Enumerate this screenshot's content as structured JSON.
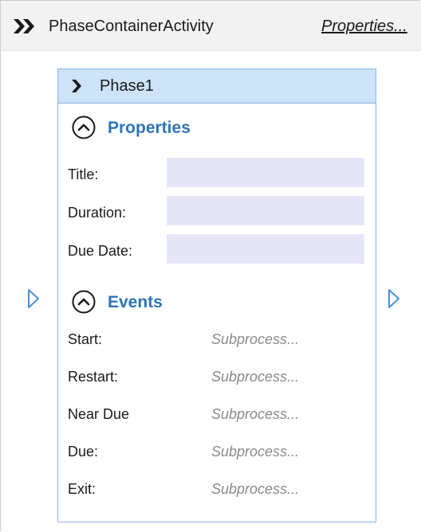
{
  "container": {
    "title": "PhaseContainerActivity",
    "properties_link": "Properties...",
    "icon": "double-chevron-right-icon"
  },
  "phase": {
    "title": "Phase1",
    "icon": "chevron-right-icon",
    "properties_section": {
      "title": "Properties",
      "icon": "chevron-up-circle-icon",
      "fields": [
        {
          "label": "Title:",
          "value": ""
        },
        {
          "label": "Duration:",
          "value": ""
        },
        {
          "label": "Due Date:",
          "value": ""
        }
      ]
    },
    "events_section": {
      "title": "Events",
      "icon": "chevron-up-circle-icon",
      "events": [
        {
          "label": "Start:",
          "value": "Subprocess..."
        },
        {
          "label": "Restart:",
          "value": "Subprocess..."
        },
        {
          "label": "Near Due",
          "value": "Subprocess..."
        },
        {
          "label": "Due:",
          "value": "Subprocess..."
        },
        {
          "label": "Exit:",
          "value": "Subprocess..."
        }
      ]
    }
  },
  "connectors": {
    "left_icon": "triangle-right-outline-icon",
    "right_icon": "triangle-right-outline-icon"
  },
  "colors": {
    "accent": "#2e75b6",
    "phase_header": "#cde3f7",
    "phase_border": "#85b3e0",
    "input_bg": "#e6e6f7",
    "connector": "#4a90d9"
  }
}
